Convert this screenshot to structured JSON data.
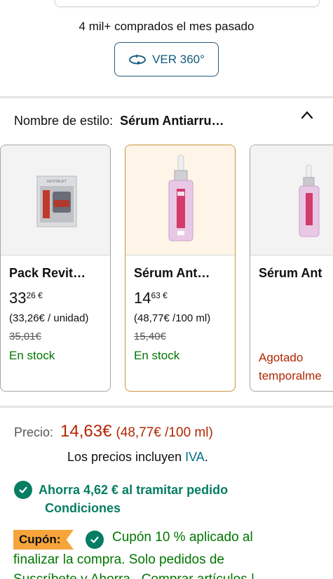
{
  "summary": {
    "bought_text": "4 mil+ comprados el mes pasado",
    "view360_label": "VER 360°"
  },
  "style": {
    "label": "Nombre de estilo:",
    "value": "Sérum Antiarru…"
  },
  "variants": [
    {
      "title": "Pack Revit…",
      "price_whole": "33",
      "price_cents": "26 €",
      "unit_price": "(33,26€ / unidad)",
      "old_price": "35,01€",
      "stock": "En stock"
    },
    {
      "title": "Sérum Ant…",
      "price_whole": "14",
      "price_cents": "63 €",
      "unit_price": "(48,77€ /100 ml)",
      "old_price": "15,40€",
      "stock": "En stock"
    },
    {
      "title": "Sérum Ant",
      "stock_line1": "Agotado",
      "stock_line2": "temporalme"
    }
  ],
  "price": {
    "label": "Precio:",
    "value": "14,63€",
    "unit": "(48,77€ /100 ml)"
  },
  "tax": {
    "text": "Los precios incluyen",
    "link": "IVA",
    "end": "."
  },
  "savings": {
    "text": "Ahorra 4,62 € al tramitar pedido",
    "conditions": "Condiciones"
  },
  "coupon": {
    "badge": "Cupón:",
    "line1": "Cupón 10 % aplicado al",
    "line2": "finalizar la compra. Solo pedidos de",
    "line3": "Suscríbete y Ahorra . Comprar artículos |"
  },
  "colors": {
    "price_red": "#b12704",
    "stock_green": "#007600",
    "save_green": "#067d62",
    "link_teal": "#007185",
    "coupon_orange": "#f7a43b",
    "selected_border": "#c8963e"
  }
}
